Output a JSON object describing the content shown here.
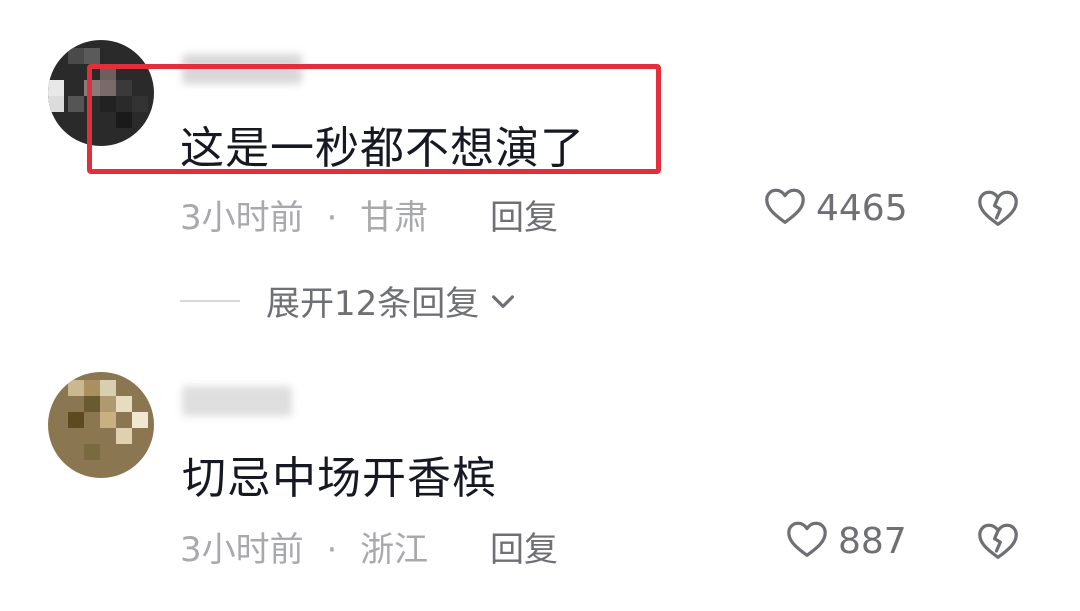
{
  "comments": [
    {
      "text": "这是一秒都不想演了",
      "time": "3小时前",
      "separator": "·",
      "location": "甘肃",
      "reply_label": "回复",
      "likes": "4465",
      "expand_label": "展开12条回复"
    },
    {
      "text": "切忌中场开香槟",
      "time": "3小时前",
      "separator": "·",
      "location": "浙江",
      "reply_label": "回复",
      "likes": "887"
    }
  ],
  "icons": {
    "like": "heart-outline-icon",
    "dislike": "broken-heart-icon",
    "expand": "chevron-down-icon"
  },
  "colors": {
    "highlight": "#e0303d",
    "text_primary": "#161823",
    "text_meta": "#a8a9ad",
    "text_secondary": "#6f7075"
  }
}
